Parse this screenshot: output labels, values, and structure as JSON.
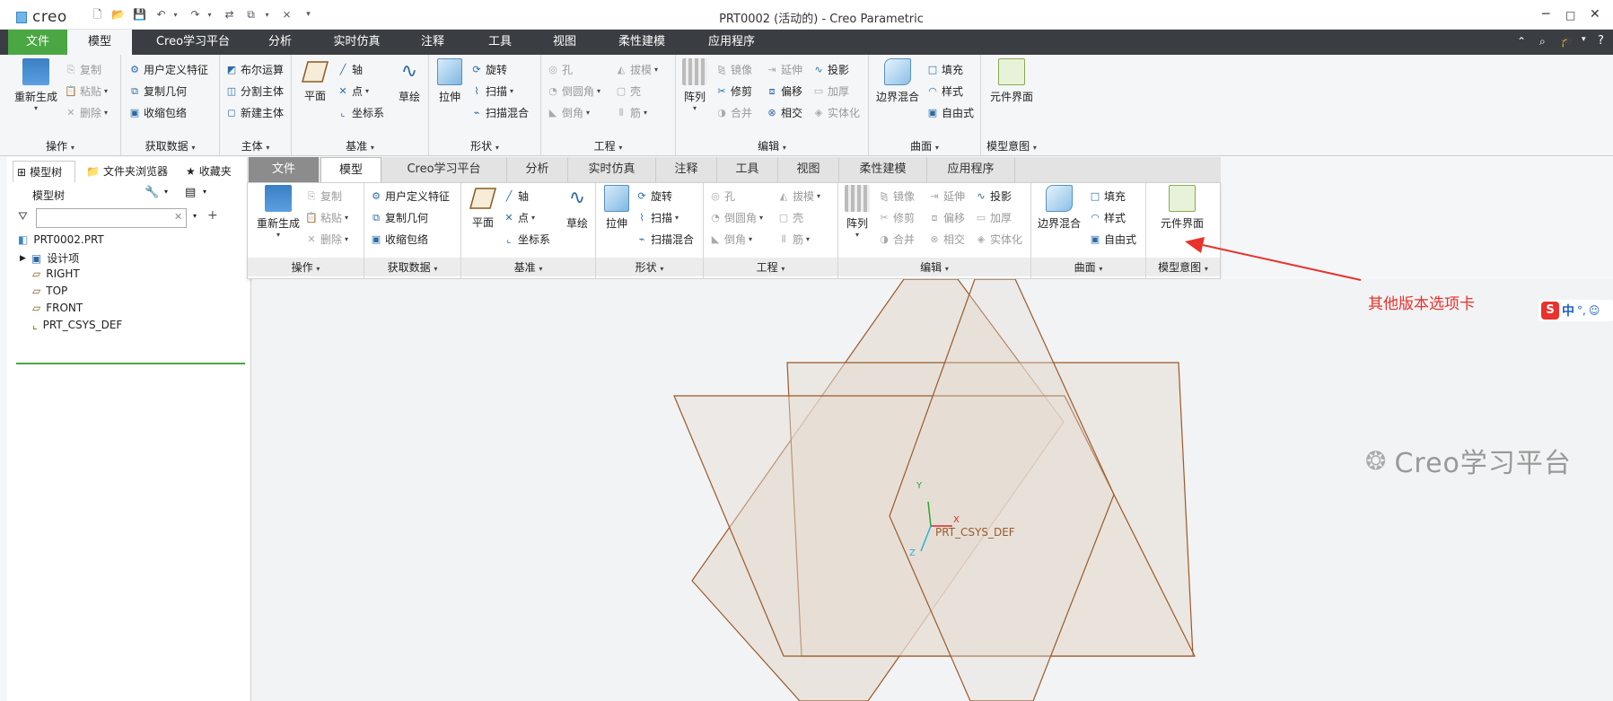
{
  "app": {
    "name": "creo",
    "window_title": "PRT0002 (活动的) - Creo Parametric"
  },
  "main_tabs": [
    "文件",
    "模型",
    "Creo学习平台",
    "分析",
    "实时仿真",
    "注释",
    "工具",
    "视图",
    "柔性建模",
    "应用程序"
  ],
  "ribbon": {
    "groups": [
      "操作",
      "获取数据",
      "主体",
      "基准",
      "形状",
      "工程",
      "编辑",
      "曲面",
      "模型意图"
    ],
    "operate": {
      "regen": "重新生成",
      "copy": "复制",
      "paste": "粘贴",
      "delete": "删除"
    },
    "getdata": {
      "udf": "用户定义特征",
      "copygeom": "复制几何",
      "shrinkwrap": "收缩包络"
    },
    "body": {
      "boolean": "布尔运算",
      "split": "分割主体",
      "newbody": "新建主体"
    },
    "datum": {
      "plane": "平面",
      "axis": "轴",
      "point": "点",
      "csys": "坐标系",
      "sketch": "草绘"
    },
    "shape": {
      "extrude": "拉伸",
      "revolve": "旋转",
      "sweep": "扫描",
      "swept_blend": "扫描混合"
    },
    "eng": {
      "hole": "孔",
      "round": "倒圆角",
      "chamfer": "倒角",
      "draft": "拔模",
      "shell": "壳",
      "rib": "筋"
    },
    "edit": {
      "pattern": "阵列",
      "mirror": "镜像",
      "trim": "修剪",
      "merge": "合并",
      "extend": "延伸",
      "offset": "偏移",
      "intersect": "相交",
      "project": "投影",
      "thicken": "加厚",
      "solidify": "实体化"
    },
    "surface": {
      "boundary": "边界混合",
      "fill": "填充",
      "style": "样式",
      "freestyle": "自由式"
    },
    "intent": {
      "component_interface": "元件界面"
    }
  },
  "left_panel": {
    "tabs": [
      "模型树",
      "文件夹浏览器",
      "收藏夹"
    ],
    "header": "模型树",
    "search_placeholder": "",
    "tree": [
      "PRT0002.PRT",
      "设计项",
      "RIGHT",
      "TOP",
      "FRONT",
      "PRT_CSYS_DEF"
    ]
  },
  "annotation": "其他版本选项卡",
  "csys": {
    "label": "PRT_CSYS_DEF",
    "x": "X",
    "y": "Y",
    "z": "Z"
  },
  "ime": {
    "lang": "中"
  },
  "watermark": "Creo学习平台",
  "colors": {
    "file_tab": "#4aa743",
    "tab_bar": "#3a3e42",
    "annotation": "#e8322b",
    "plane_edge": "#9a5a2a",
    "plane_fill": "#e6ddd4"
  }
}
